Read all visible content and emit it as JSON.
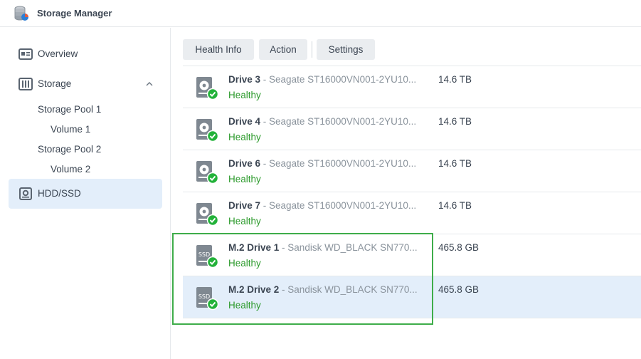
{
  "app": {
    "title": "Storage Manager"
  },
  "sidebar": {
    "overview": {
      "label": "Overview",
      "icon": "overview-icon"
    },
    "storage": {
      "label": "Storage",
      "icon": "storage-icon"
    },
    "sub_items": [
      "Storage Pool 1",
      "Volume 1",
      "Storage Pool 2",
      "Volume 2"
    ],
    "hdd_ssd": {
      "label": "HDD/SSD",
      "icon": "hdd-icon"
    }
  },
  "toolbar": {
    "health_info": "Health Info",
    "action": "Action",
    "settings": "Settings"
  },
  "drives": [
    {
      "name": "Drive 3",
      "model": " - Seagate ST16000VN001-2YU10...",
      "size": "14.6 TB",
      "status": "Healthy",
      "type": "hdd"
    },
    {
      "name": "Drive 4",
      "model": " - Seagate ST16000VN001-2YU10...",
      "size": "14.6 TB",
      "status": "Healthy",
      "type": "hdd"
    },
    {
      "name": "Drive 6",
      "model": " - Seagate ST16000VN001-2YU10...",
      "size": "14.6 TB",
      "status": "Healthy",
      "type": "hdd"
    },
    {
      "name": "Drive 7",
      "model": " - Seagate ST16000VN001-2YU10...",
      "size": "14.6 TB",
      "status": "Healthy",
      "type": "hdd"
    },
    {
      "name": "M.2 Drive 1",
      "model": " - Sandisk WD_BLACK SN770...",
      "size": "465.8 GB",
      "status": "Healthy",
      "type": "ssd"
    },
    {
      "name": "M.2 Drive 2",
      "model": " - Sandisk WD_BLACK SN770...",
      "size": "465.8 GB",
      "status": "Healthy",
      "type": "ssd"
    }
  ],
  "ssd_icon_text": "SSD",
  "colors": {
    "accent_bg": "#e3eefa",
    "healthy": "#2b9a2b",
    "highlight": "#3fad4a"
  }
}
